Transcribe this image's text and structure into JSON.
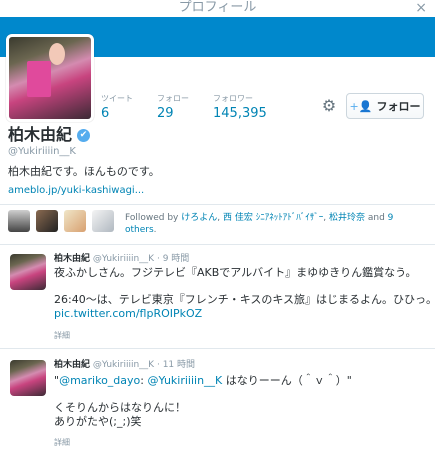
{
  "header": {
    "title": "プロフィール",
    "close_label": "×"
  },
  "stats": [
    {
      "label": "ツイート",
      "value": "6"
    },
    {
      "label": "フォロー",
      "value": "29"
    },
    {
      "label": "フォロワー",
      "value": "145,395"
    }
  ],
  "gear_label": "⚙",
  "follow_button": {
    "icon": "+👤",
    "label": "フォロー"
  },
  "profile": {
    "name": "柏木由紀",
    "verified_mark": "✔",
    "handle": "@Yukiriiiin__K",
    "bio": "柏木由紀です。ほんものです。",
    "url": "ameblo.jp/yuki-kashiwagi..."
  },
  "followed_by": {
    "prefix": "Followed by ",
    "names": [
      "けろよん",
      "西 佳宏 ｼﾆｱﾈｯﾄｱﾄﾞﾊﾞｲｻﾞｰ",
      "松井玲奈"
    ],
    "sep1": ", ",
    "sep2": ", ",
    "and": " and ",
    "others": "9 others",
    "end": "."
  },
  "tweets": [
    {
      "name": "柏木由紀",
      "handle": "@Yukiriiiin__K",
      "time": "· 9 時間",
      "line1": "夜ふかしさん。フジテレビ『AKBでアルバイト』まゆゆきりん鑑賞なう。",
      "line2": "26:40～は、テレビ東京『フレンチ・キスのキス旅』はじまるよん。ひひっ。",
      "link": "pic.twitter.com/flpROIPkOZ",
      "detail": "詳細"
    },
    {
      "name": "柏木由紀",
      "handle": "@Yukiriiiin__K",
      "time": "· 11 時間",
      "quote_open": "\"",
      "mention1": "@mariko_dayo",
      "colon": ": ",
      "mention2": "@Yukiriiiin__K",
      "quote_text": " はなりーーん（＾ｖ＾）\"",
      "line2": "くそりんからはなりんに！",
      "line3": "ありがたや(;_;)笑",
      "detail": "詳細"
    }
  ],
  "colors": {
    "banner": "#0088cc",
    "link": "#0084b4",
    "muted": "#8899a6"
  }
}
